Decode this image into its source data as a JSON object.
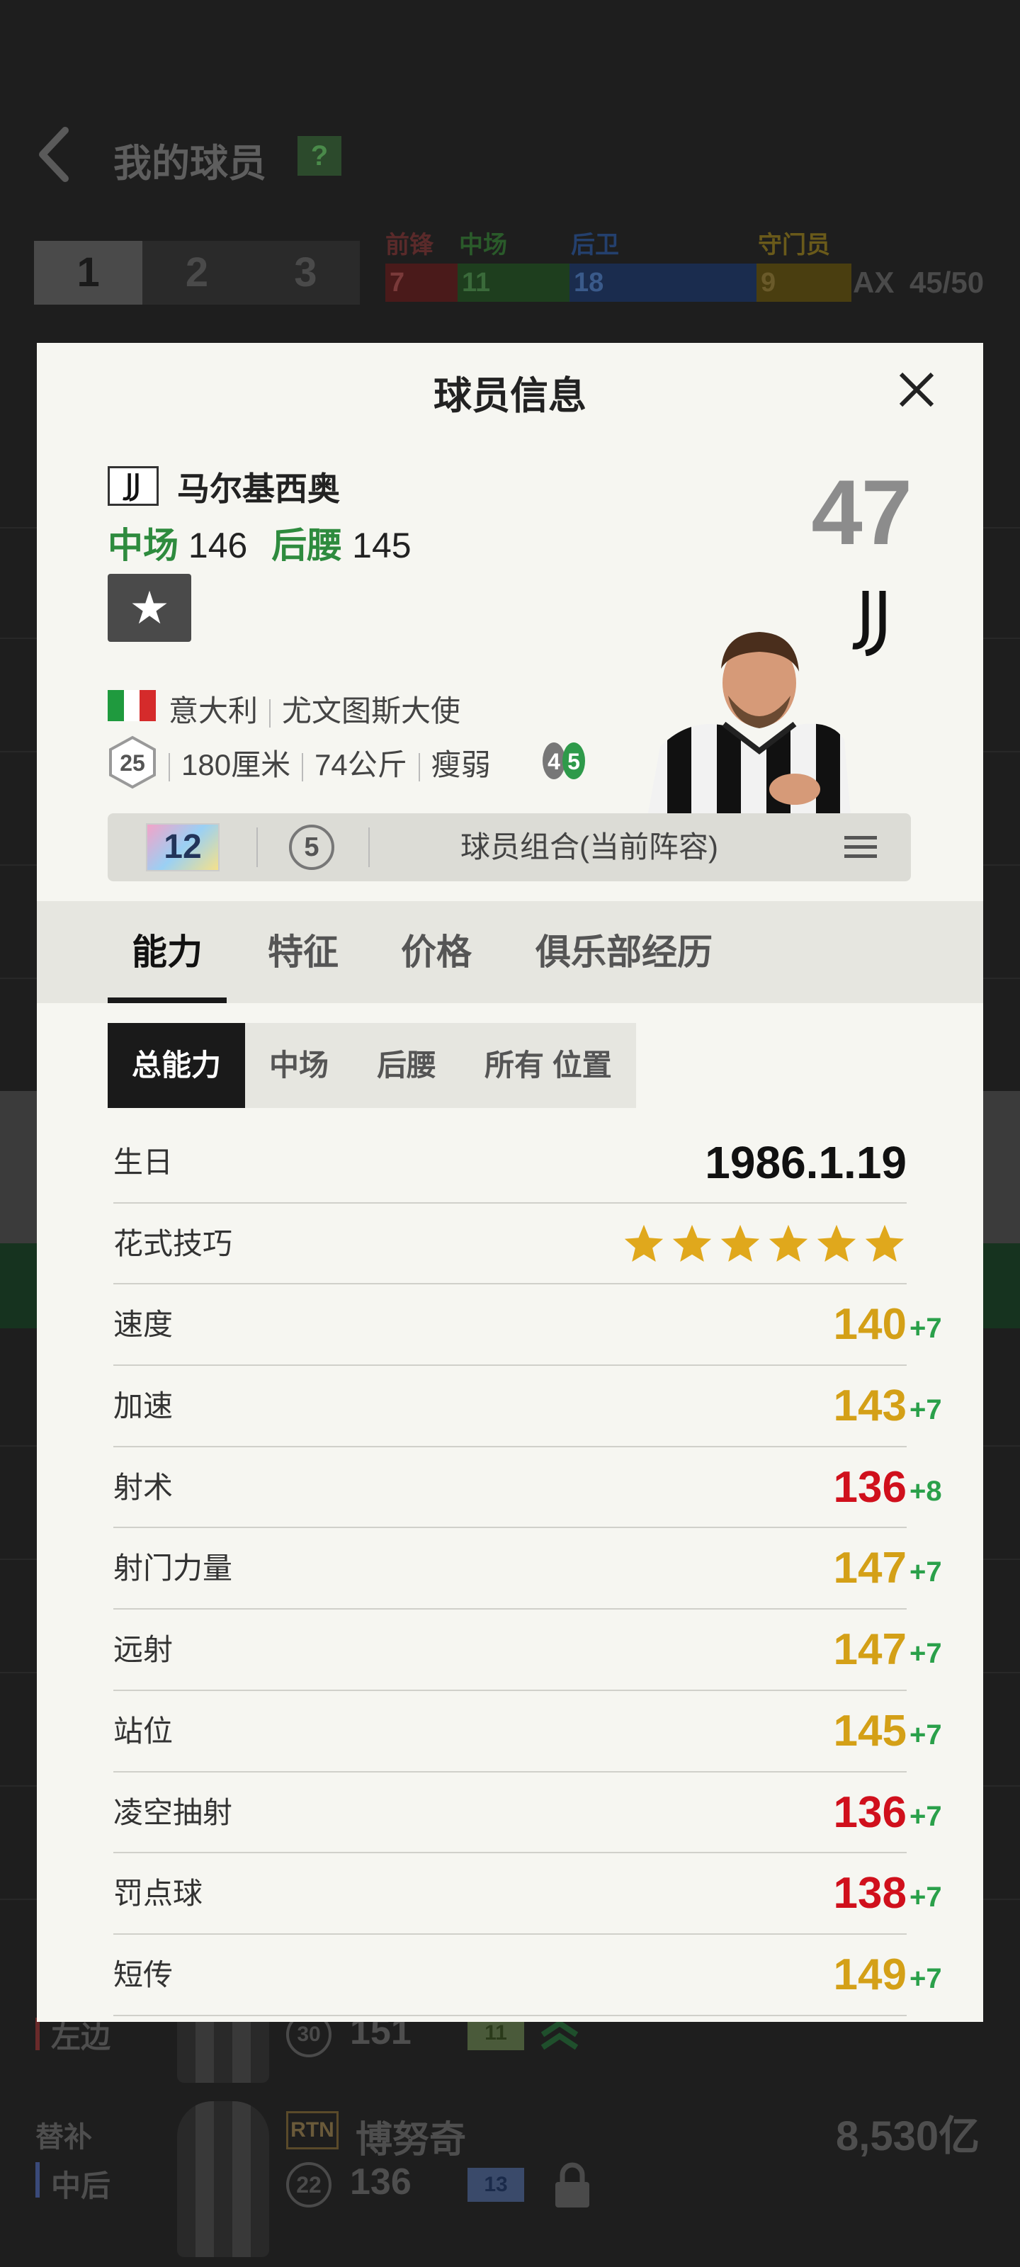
{
  "background": {
    "title": "我的球员",
    "help_label": "?",
    "lineup_tabs": [
      "1",
      "2",
      "3"
    ],
    "position_labels": {
      "fw": "前锋",
      "mf": "中场",
      "df": "后卫",
      "gk": "守门员"
    },
    "position_counts": {
      "fw": "7",
      "mf": "11",
      "df": "18",
      "gk": "9"
    },
    "max_label": "AX",
    "squad_count": "45/50",
    "row1_position": "左边",
    "row1_age": "30",
    "row1_ovr": "151",
    "row1_card": "11",
    "sub_label": "替补",
    "sub_position": "中后",
    "sub_badge": "RTN",
    "sub_name": "博努奇",
    "sub_age": "22",
    "sub_ovr": "136",
    "sub_card": "13",
    "sub_price": "8,530亿",
    "colors": {
      "fw": "#6a2a2a",
      "mf": "#2a5a2a",
      "df": "#24406e",
      "gk": "#6a5a1a"
    }
  },
  "modal": {
    "title": "球员信息",
    "player": {
      "name": "马尔基西奥",
      "positions": [
        {
          "pos": "中场",
          "value": "146"
        },
        {
          "pos": "后腰",
          "value": "145"
        }
      ],
      "overall": "47",
      "nation": "意大利",
      "club_role": "尤文图斯大使",
      "age": "25",
      "height": "180厘米",
      "weight": "74公斤",
      "body_type": "瘦弱",
      "foot_left": "4",
      "foot_right": "5"
    },
    "combo": {
      "card_level": "12",
      "circle_value": "5",
      "label": "球员组合(当前阵容)"
    },
    "tabs": [
      "能力",
      "特征",
      "价格",
      "俱乐部经历"
    ],
    "sub_tabs": [
      "总能力",
      "中场",
      "后腰",
      "所有 位置"
    ],
    "stats": [
      {
        "label": "生日",
        "value": "1986.1.19",
        "bonus": "",
        "color": "#111111"
      },
      {
        "label": "花式技巧",
        "stars": 6,
        "color": "#e0a81c"
      },
      {
        "label": "速度",
        "value": "140",
        "bonus": "+7",
        "color": "#d4a017"
      },
      {
        "label": "加速",
        "value": "143",
        "bonus": "+7",
        "color": "#d4a017"
      },
      {
        "label": "射术",
        "value": "136",
        "bonus": "+8",
        "color": "#d0101c"
      },
      {
        "label": "射门力量",
        "value": "147",
        "bonus": "+7",
        "color": "#d4a017"
      },
      {
        "label": "远射",
        "value": "147",
        "bonus": "+7",
        "color": "#d4a017"
      },
      {
        "label": "站位",
        "value": "145",
        "bonus": "+7",
        "color": "#d4a017"
      },
      {
        "label": "凌空抽射",
        "value": "136",
        "bonus": "+7",
        "color": "#d0101c"
      },
      {
        "label": "罚点球",
        "value": "138",
        "bonus": "+7",
        "color": "#d0101c"
      },
      {
        "label": "短传",
        "value": "149",
        "bonus": "+7",
        "color": "#d4a017"
      }
    ]
  }
}
